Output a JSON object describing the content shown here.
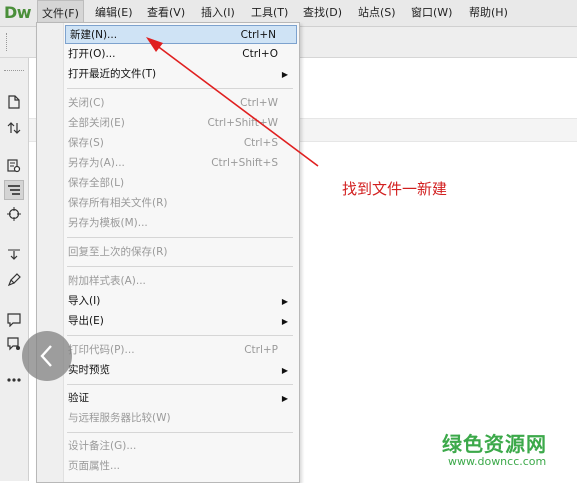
{
  "app": {
    "logo": "Dw"
  },
  "menubar": {
    "items": [
      {
        "label": "文件(F)"
      },
      {
        "label": "编辑(E)"
      },
      {
        "label": "查看(V)"
      },
      {
        "label": "插入(I)"
      },
      {
        "label": "工具(T)"
      },
      {
        "label": "查找(D)"
      },
      {
        "label": "站点(S)"
      },
      {
        "label": "窗口(W)"
      },
      {
        "label": "帮助(H)"
      }
    ]
  },
  "left_panel": {
    "icons": [
      {
        "name": "document-icon",
        "glyph": "🗋"
      },
      {
        "name": "sort-arrows-icon",
        "glyph": "⇅"
      },
      {
        "name": "inspect-icon",
        "glyph": "🔍"
      },
      {
        "name": "align-icon",
        "glyph": "≡"
      },
      {
        "name": "target-icon",
        "glyph": "⌖"
      },
      {
        "name": "expand-icon",
        "glyph": "↕"
      },
      {
        "name": "brush-icon",
        "glyph": "✎"
      },
      {
        "name": "comment-icon",
        "glyph": "💬"
      },
      {
        "name": "comment-settings-icon",
        "glyph": "💬"
      },
      {
        "name": "more-icon",
        "glyph": "•••"
      }
    ]
  },
  "file_menu": {
    "items": [
      {
        "label": "新建(N)...",
        "shortcut": "Ctrl+N",
        "enabled": true,
        "highlight": true
      },
      {
        "label": "打开(O)...",
        "shortcut": "Ctrl+O",
        "enabled": true
      },
      {
        "label": "打开最近的文件(T)",
        "submenu": true,
        "enabled": true
      },
      {
        "label": "关闭(C)",
        "shortcut": "Ctrl+W",
        "enabled": false
      },
      {
        "label": "全部关闭(E)",
        "shortcut": "Ctrl+Shift+W",
        "enabled": false
      },
      {
        "label": "保存(S)",
        "shortcut": "Ctrl+S",
        "enabled": false
      },
      {
        "label": "另存为(A)...",
        "shortcut": "Ctrl+Shift+S",
        "enabled": false
      },
      {
        "label": "保存全部(L)",
        "enabled": false
      },
      {
        "label": "保存所有相关文件(R)",
        "enabled": false
      },
      {
        "label": "另存为模板(M)...",
        "enabled": false
      },
      {
        "label": "回复至上次的保存(R)",
        "enabled": false
      },
      {
        "label": "附加样式表(A)...",
        "enabled": false
      },
      {
        "label": "导入(I)",
        "submenu": true,
        "enabled": true
      },
      {
        "label": "导出(E)",
        "submenu": true,
        "enabled": true
      },
      {
        "label": "打印代码(P)...",
        "shortcut": "Ctrl+P",
        "enabled": false
      },
      {
        "label": "实时预览",
        "submenu": true,
        "enabled": true
      },
      {
        "label": "验证",
        "submenu": true,
        "enabled": true
      },
      {
        "label": "与远程服务器比较(W)",
        "enabled": false
      },
      {
        "label": "设计备注(G)...",
        "enabled": false
      },
      {
        "label": "页面属性...",
        "enabled": false
      }
    ],
    "submenu_arrow": "▶"
  },
  "annotation": {
    "text": "找到文件一新建",
    "color": "#d21f1f"
  },
  "back_button": {
    "glyph": "〈"
  },
  "watermark": {
    "logo": "绿色资源网",
    "url": "www.downcc.com",
    "color": "#3ca94a"
  }
}
